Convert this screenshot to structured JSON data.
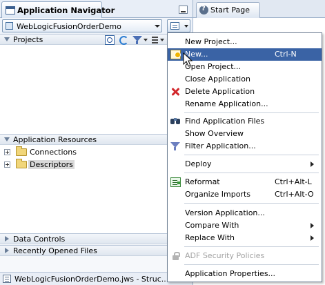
{
  "navigator": {
    "title": "Application Navigator",
    "application_selector": {
      "value": "WebLogicFusionOrderDemo"
    },
    "sections": {
      "projects": {
        "label": "Projects"
      },
      "application_resources": {
        "label": "Application Resources",
        "items": [
          {
            "label": "Connections"
          },
          {
            "label": "Descriptors"
          }
        ]
      },
      "data_controls": {
        "label": "Data Controls"
      },
      "recently_opened_files": {
        "label": "Recently Opened Files"
      }
    },
    "bottom_tab": {
      "label": "WebLogicFusionOrderDemo.jws - Struc..."
    }
  },
  "editor": {
    "tabs": [
      {
        "label": "Start Page"
      }
    ]
  },
  "context_menu": {
    "items": [
      {
        "label": "New Project...",
        "mnemonic": "N"
      },
      {
        "label": "New...",
        "accelerator": "Ctrl-N",
        "icon": "new-gallery-icon",
        "highlighted": true
      },
      {
        "label": "Open Project...",
        "mnemonic": "O"
      },
      {
        "label": "Close Application",
        "mnemonic": "C"
      },
      {
        "label": "Delete Application",
        "icon": "delete-icon",
        "mnemonic": "D"
      },
      {
        "label": "Rename Application...",
        "mnemonic": "m"
      },
      {
        "label": "Find Application Files",
        "icon": "binoculars-icon",
        "mnemonic": "i"
      },
      {
        "label": "Show Overview",
        "mnemonic": "S"
      },
      {
        "label": "Filter Application...",
        "icon": "filter-icon",
        "mnemonic": "F"
      },
      {
        "label": "Deploy",
        "submenu": true,
        "mnemonic": "y"
      },
      {
        "label": "Reformat",
        "accelerator": "Ctrl+Alt-L",
        "icon": "reformat-icon",
        "mnemonic": "R"
      },
      {
        "label": "Organize Imports",
        "accelerator": "Ctrl+Alt-O"
      },
      {
        "label": "Version Application...",
        "mnemonic": "V"
      },
      {
        "label": "Compare With",
        "submenu": true,
        "mnemonic": "W"
      },
      {
        "label": "Replace With",
        "submenu": true,
        "mnemonic": "W"
      },
      {
        "label": "ADF Security Policies",
        "disabled": true,
        "icon": "lock-icon"
      },
      {
        "label": "Application Properties...",
        "mnemonic": "A"
      }
    ]
  },
  "colors": {
    "menu_highlight": "#3a63a5",
    "delete_icon": "#d2272c",
    "disabled_text": "#a2a2a2"
  }
}
